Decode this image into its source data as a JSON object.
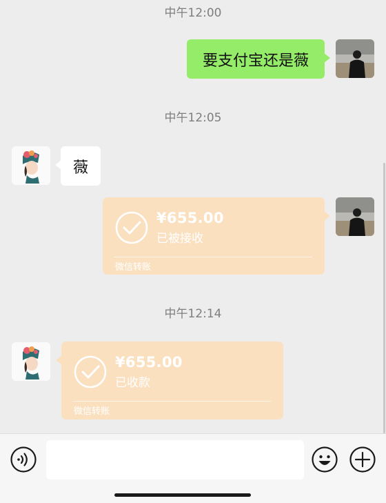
{
  "messages": [
    {
      "time": "中午12:00"
    },
    {
      "sender": "me",
      "text": "要支付宝还是薇"
    },
    {
      "time": "中午12:05"
    },
    {
      "sender": "contact",
      "text": "薇"
    },
    {
      "sender": "me",
      "transfer": {
        "amount": "¥655.00",
        "status": "已被接收",
        "label": "微信转账"
      }
    },
    {
      "time": "中午12:14"
    },
    {
      "sender": "contact",
      "transfer": {
        "amount": "¥655.00",
        "status": "已收款",
        "label": "微信转账"
      }
    }
  ],
  "input_bar": {
    "left_icon": "voice-icon",
    "right_icons": [
      "emoji-icon",
      "plus-icon"
    ],
    "input_value": ""
  },
  "colors": {
    "background": "#ededed",
    "my_bubble": "#95ec69",
    "their_bubble": "#ffffff",
    "transfer_card": "#fbe0c0"
  }
}
